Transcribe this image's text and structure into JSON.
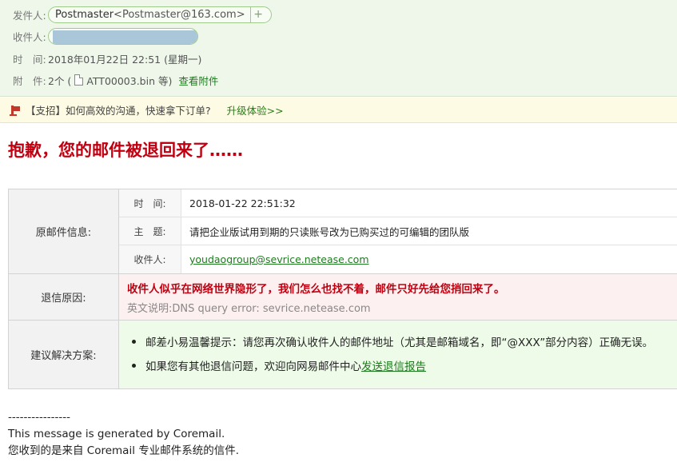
{
  "header": {
    "from_label": "发件人:",
    "from_name": "Postmaster",
    "from_addr": "<Postmaster@163.com>",
    "to_label": "收件人:",
    "time_label": "时　间:",
    "time_value": "2018年01月22日 22:51 (星期一)",
    "attach_label": "附　件:",
    "attach_count": "2个 (",
    "attach_file": "ATT00003.bin 等)",
    "attach_view": "查看附件"
  },
  "ad": {
    "text": "【支招】如何高效的沟通，快速拿下订单?",
    "link": "升级体验>>"
  },
  "bounce": {
    "title": "抱歉，您的邮件被退回来了……"
  },
  "table": {
    "orig_label": "原邮件信息:",
    "orig_rows": [
      {
        "key": "时　间:",
        "value": "2018-01-22 22:51:32"
      },
      {
        "key": "主　题:",
        "value": "请把企业版试用到期的只读账号改为已购买过的可编辑的团队版"
      },
      {
        "key": "收件人:",
        "value": "youdaogroup@sevrice.netease.com"
      }
    ],
    "reason_label": "退信原因:",
    "reason_main": "收件人似乎在网络世界隐形了，我们怎么也找不着，邮件只好先给您捎回来了。",
    "reason_sub": "英文说明:DNS query error: sevrice.netease.com",
    "suggest_label": "建议解决方案:",
    "suggest_1": "邮差小易温馨提示：请您再次确认收件人的邮件地址（尤其是邮箱域名，即“@XXX”部分内容）正确无误。",
    "suggest_2_text": "如果您有其他退信问题，欢迎向网易邮件中心",
    "suggest_2_link": "发送退信报告"
  },
  "footer": {
    "divider": "----------------",
    "line1": "This message is generated by Coremail.",
    "line2": "您收到的是来自 Coremail 专业邮件系统的信件."
  },
  "colors": {
    "title_red": "#c00010",
    "link_green": "#1e7a1e",
    "header_bg": "#eef7ea"
  }
}
